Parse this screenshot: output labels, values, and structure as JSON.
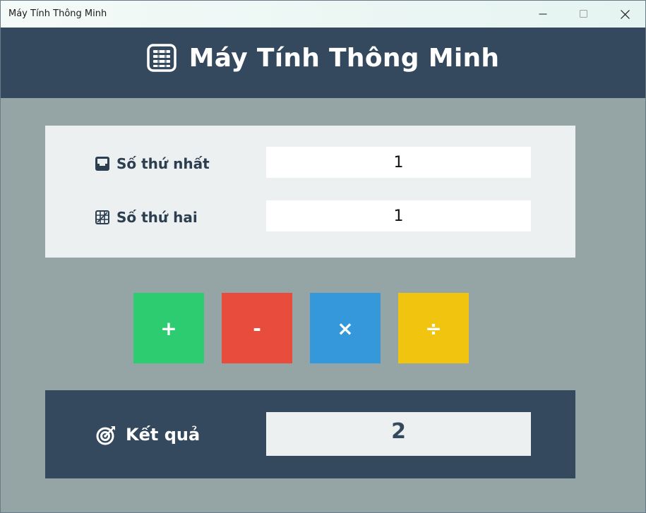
{
  "window": {
    "title": "Máy Tính Thông Minh"
  },
  "header": {
    "title": "Máy Tính Thông Minh",
    "icon": "abacus-icon"
  },
  "inputs": [
    {
      "label": "Số thứ nhất",
      "value": "1",
      "icon": "inbox-icon"
    },
    {
      "label": "Số thứ hai",
      "value": "1",
      "icon": "grid-icon"
    }
  ],
  "operations": [
    {
      "symbol": "+",
      "color": "#2ecc71"
    },
    {
      "symbol": "-",
      "color": "#e74c3c"
    },
    {
      "symbol": "×",
      "color": "#3498db"
    },
    {
      "symbol": "÷",
      "color": "#f1c40f"
    }
  ],
  "result": {
    "label": "Kết quả",
    "value": "2",
    "icon": "target-icon"
  },
  "colors": {
    "background": "#95a5a6",
    "header": "#34495e",
    "panel": "#ecf0f1",
    "text_dark": "#2c3e50"
  }
}
